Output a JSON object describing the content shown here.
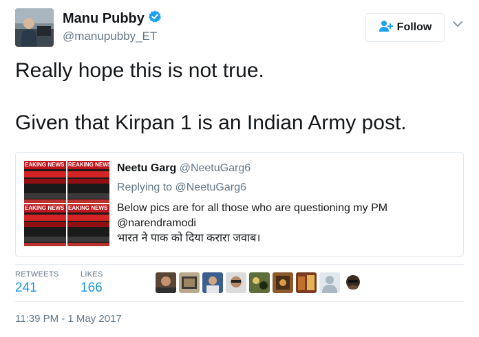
{
  "author": {
    "display_name": "Manu Pubby",
    "handle": "@manupubby_ET",
    "verified": true
  },
  "follow_button": {
    "label": "Follow",
    "icon": "add-user-icon"
  },
  "tweet": {
    "line1": "Really hope this is not true.",
    "line2": "Given that Kirpan 1 is an Indian Army post."
  },
  "quoted_tweet": {
    "display_name": "Neetu Garg",
    "handle": "@NeetuGarg6",
    "replying_to": "Replying to @NeetuGarg6",
    "text_line1": "Below pics are for all those who are questioning my PM",
    "text_line2": "@narendramodi",
    "text_line3": "भारत ने पाक को दिया करारा जवाब।",
    "media_labels": [
      "EAKING NEWS",
      "REAKING NEWS",
      "EAKING NEWS",
      "EAKING NEWS"
    ]
  },
  "stats": {
    "retweets_label": "RETWEETS",
    "retweets_value": "241",
    "likes_label": "LIKES",
    "likes_value": "166"
  },
  "timestamp": "11:39 PM - 1 May 2017",
  "colors": {
    "link_blue": "#1b95e0",
    "verified_blue": "#1da1f2",
    "secondary_text": "#657786",
    "border": "#e1e8ed",
    "breaking_news_red": "#c0161d"
  }
}
